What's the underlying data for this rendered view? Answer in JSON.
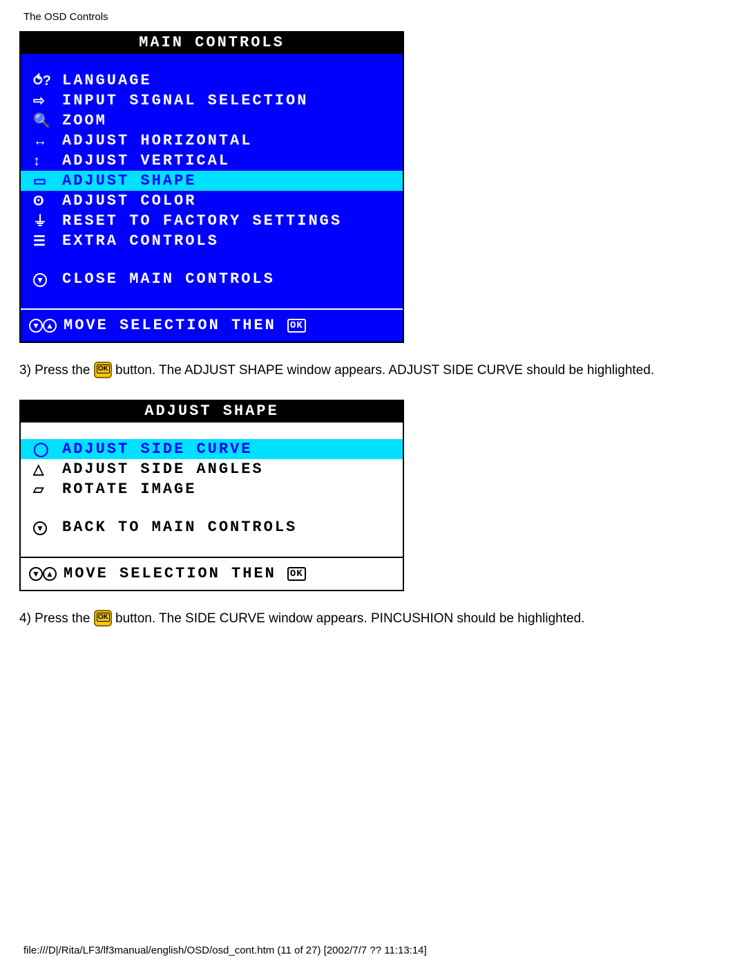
{
  "page_header": "The OSD Controls",
  "main_osd": {
    "title": "MAIN CONTROLS",
    "items": [
      {
        "icon": "⥀?",
        "label": "LANGUAGE"
      },
      {
        "icon": "⇨",
        "label": "INPUT SIGNAL SELECTION"
      },
      {
        "icon": "🔍",
        "label": "ZOOM"
      },
      {
        "icon": "↔",
        "label": "ADJUST HORIZONTAL"
      },
      {
        "icon": "↕",
        "label": "ADJUST VERTICAL"
      },
      {
        "icon": "▭",
        "label": "ADJUST SHAPE",
        "selected": true
      },
      {
        "icon": "ʘ",
        "label": "ADJUST COLOR"
      },
      {
        "icon": "⏚",
        "label": "RESET TO FACTORY SETTINGS"
      },
      {
        "icon": "☰",
        "label": "EXTRA CONTROLS"
      }
    ],
    "close": {
      "icon": "▼",
      "label": "CLOSE MAIN CONTROLS"
    },
    "footer": "MOVE SELECTION THEN",
    "footer_ok": "OK"
  },
  "instr_3_a": "3) Press the ",
  "instr_3_b": " button. The ADJUST SHAPE window appears. ADJUST SIDE CURVE should be highlighted.",
  "shape_osd": {
    "title": "ADJUST SHAPE",
    "items": [
      {
        "icon": "◯",
        "label": "ADJUST SIDE CURVE",
        "selected": true
      },
      {
        "icon": "△",
        "label": "ADJUST SIDE ANGLES"
      },
      {
        "icon": "▱",
        "label": "ROTATE IMAGE"
      }
    ],
    "back": {
      "icon": "▼",
      "label": "BACK TO MAIN CONTROLS"
    },
    "footer": "MOVE SELECTION THEN",
    "footer_ok": "OK"
  },
  "instr_4_a": "4) Press the ",
  "instr_4_b": " button. The SIDE CURVE window appears. PINCUSHION should be highlighted.",
  "footer_path": "file:///D|/Rita/LF3/lf3manual/english/OSD/osd_cont.htm (11 of 27) [2002/7/7 ?? 11:13:14]"
}
